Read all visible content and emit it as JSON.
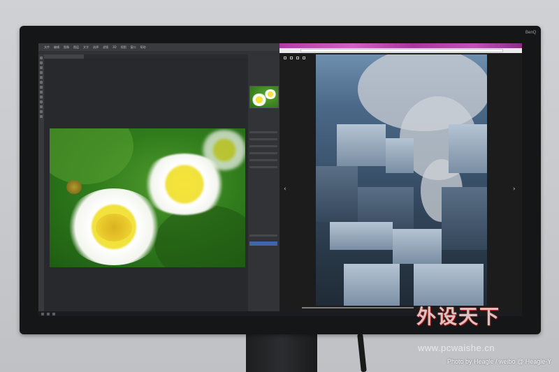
{
  "monitor": {
    "brand": "BenQ"
  },
  "photoshop": {
    "menu": [
      "文件",
      "编辑",
      "图像",
      "图层",
      "文字",
      "选择",
      "滤镜",
      "3D",
      "视图",
      "窗口",
      "帮助"
    ]
  },
  "watermark": {
    "logo": "外设天下",
    "url": "www.pcwaishe.cn",
    "credit": "Photo by Heagle / weibo @ Heagle-Y"
  },
  "colors": {
    "bezel": "#151618",
    "leaf_green": "#2f7b1c",
    "petal_white": "#f3f5ee",
    "flower_yellow": "#f1e23d",
    "browser_tab": "#b43aa1",
    "city_blue": "#4b6989"
  }
}
